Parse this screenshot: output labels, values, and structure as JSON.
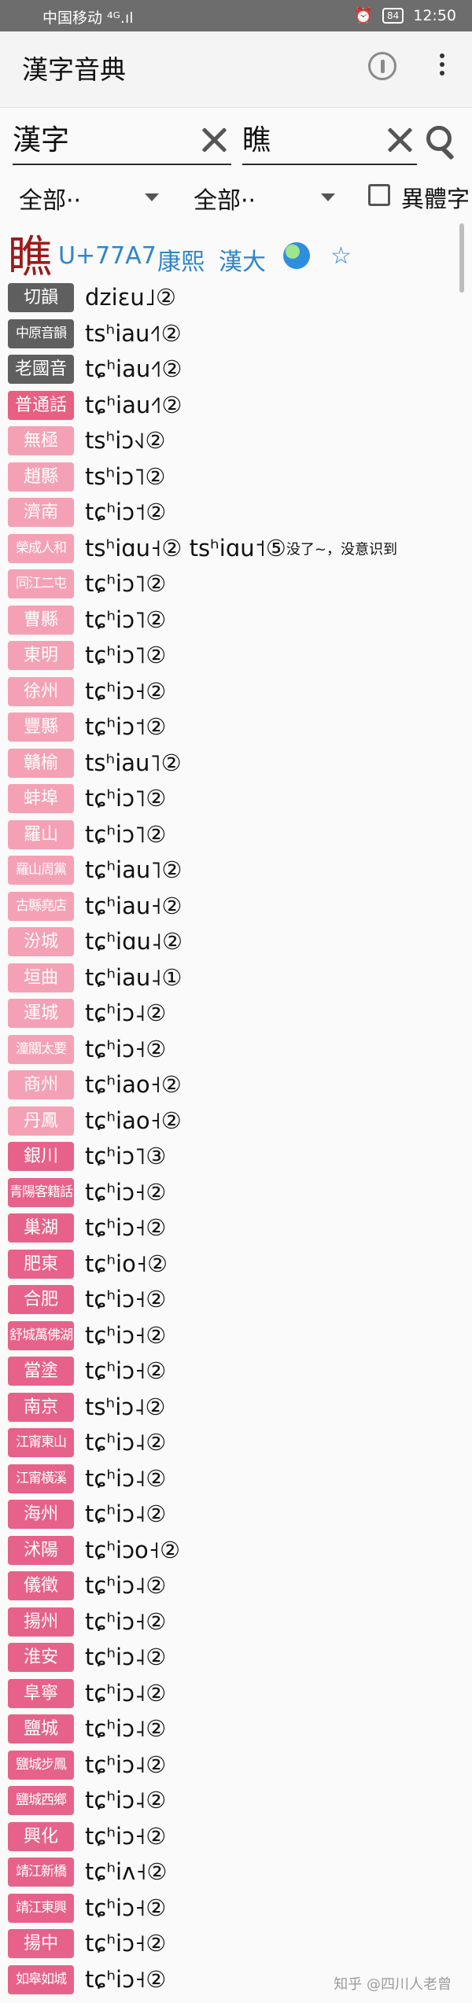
{
  "status_bar": {
    "carrier": "中国移动 ⁴ᴳ.ıl",
    "battery": "84",
    "time": "12:50"
  },
  "app": {
    "title": "漢字音典"
  },
  "search": {
    "left_value": "漢字",
    "right_value": "瞧"
  },
  "filters": {
    "left_label": "全部··",
    "right_label": "全部··",
    "variant_label": "異體字"
  },
  "entry": {
    "char": "瞧",
    "code": "U+77A7",
    "dict_1": "康熙",
    "dict_2": "漢大",
    "star": "☆"
  },
  "readings": [
    {
      "tag": "切韻",
      "style": "dark",
      "ipa": "dziɛu˩②"
    },
    {
      "tag": "中原音韻",
      "style": "dark",
      "ipa": "tsʰiau˧˥②"
    },
    {
      "tag": "老國音",
      "style": "dark",
      "ipa": "tɕʰiau˧˥②"
    },
    {
      "tag": "普通話",
      "style": "red",
      "ipa": "tɕʰiau˧˥②"
    },
    {
      "tag": "無極",
      "style": "pink",
      "ipa": "tsʰiɔ˧˩②"
    },
    {
      "tag": "趙縣",
      "style": "pink",
      "ipa": "tsʰiɔ˥②"
    },
    {
      "tag": "濟南",
      "style": "pink",
      "ipa": "tɕʰiɔ˦②"
    },
    {
      "tag": "榮成人和",
      "style": "pink",
      "ipa": "tsʰiɑu˧②  tsʰiɑu˦⑤",
      "note": "没了~，没意识到"
    },
    {
      "tag": "同江二屯",
      "style": "pink",
      "ipa": "tɕʰiɔ˥②"
    },
    {
      "tag": "曹縣",
      "style": "pink",
      "ipa": "tɕʰiɔ˥②"
    },
    {
      "tag": "東明",
      "style": "pink",
      "ipa": "tɕʰiɔ˥②"
    },
    {
      "tag": "徐州",
      "style": "pink",
      "ipa": "tɕʰiɔ˧②"
    },
    {
      "tag": "豐縣",
      "style": "pink",
      "ipa": "tɕʰiɔ˦②"
    },
    {
      "tag": "贛榆",
      "style": "pink",
      "ipa": "tsʰiau˥②"
    },
    {
      "tag": "蚌埠",
      "style": "pink",
      "ipa": "tɕʰiɔ˥②"
    },
    {
      "tag": "羅山",
      "style": "pink",
      "ipa": "tɕʰiɔ˥②"
    },
    {
      "tag": "羅山周黨",
      "style": "pink",
      "ipa": "tɕʰiau˥②"
    },
    {
      "tag": "古縣堯店",
      "style": "pink",
      "ipa": "tɕʰiau˧②"
    },
    {
      "tag": "汾城",
      "style": "pink",
      "ipa": "tɕʰiɑu˨②"
    },
    {
      "tag": "垣曲",
      "style": "pink",
      "ipa": "tɕʰiau˨①"
    },
    {
      "tag": "運城",
      "style": "pink",
      "ipa": "tɕʰiɔ˨②"
    },
    {
      "tag": "潼關太要",
      "style": "pink",
      "ipa": "tɕʰiɔ˧②"
    },
    {
      "tag": "商州",
      "style": "pink",
      "ipa": "tɕʰiao˧②"
    },
    {
      "tag": "丹鳳",
      "style": "pink",
      "ipa": "tɕʰiao˧②"
    },
    {
      "tag": "銀川",
      "style": "rose",
      "ipa": "tɕʰiɔ˥③"
    },
    {
      "tag": "青陽客籍話",
      "style": "rose",
      "ipa": "tɕʰiɔ˧②"
    },
    {
      "tag": "巢湖",
      "style": "rose",
      "ipa": "tɕʰiɔ˧②"
    },
    {
      "tag": "肥東",
      "style": "rose",
      "ipa": "tɕʰio˧②"
    },
    {
      "tag": "合肥",
      "style": "rose",
      "ipa": "tɕʰiɔ˧②"
    },
    {
      "tag": "舒城萬佛湖",
      "style": "rose",
      "ipa": "tɕʰiɔ˧②"
    },
    {
      "tag": "當塗",
      "style": "rose",
      "ipa": "tɕʰiɔ˧②"
    },
    {
      "tag": "南京",
      "style": "rose",
      "ipa": "tsʰiɔ˨②"
    },
    {
      "tag": "江甯東山",
      "style": "rose",
      "ipa": "tɕʰiɔ˨②"
    },
    {
      "tag": "江甯橫溪",
      "style": "rose",
      "ipa": "tɕʰiɔ˨②"
    },
    {
      "tag": "海州",
      "style": "rose",
      "ipa": "tɕʰiɔ˨②"
    },
    {
      "tag": "沭陽",
      "style": "rose",
      "ipa": "tɕʰiɔo˧②"
    },
    {
      "tag": "儀徵",
      "style": "rose",
      "ipa": "tɕʰiɔ˨②"
    },
    {
      "tag": "揚州",
      "style": "rose",
      "ipa": "tɕʰiɔ˧②"
    },
    {
      "tag": "淮安",
      "style": "rose",
      "ipa": "tɕʰiɔ˨②"
    },
    {
      "tag": "阜寧",
      "style": "rose",
      "ipa": "tɕʰiɔ˨②"
    },
    {
      "tag": "鹽城",
      "style": "rose",
      "ipa": "tɕʰiɔ˨②"
    },
    {
      "tag": "鹽城步鳳",
      "style": "rose",
      "ipa": "tɕʰiɔ˨②"
    },
    {
      "tag": "鹽城西鄉",
      "style": "rose",
      "ipa": "tɕʰiɔ˨②"
    },
    {
      "tag": "興化",
      "style": "rose",
      "ipa": "tɕʰiɔ˧②"
    },
    {
      "tag": "靖江新橋",
      "style": "rose",
      "ipa": "tɕʰiʌ˧②"
    },
    {
      "tag": "靖江東興",
      "style": "rose",
      "ipa": "tɕʰiɔ˧②"
    },
    {
      "tag": "揚中",
      "style": "rose",
      "ipa": "tɕʰiɔ˧②"
    },
    {
      "tag": "如皋如城",
      "style": "rose",
      "ipa": "tɕʰiɔ˧②"
    }
  ],
  "watermark": "知乎 @四川人老曾"
}
